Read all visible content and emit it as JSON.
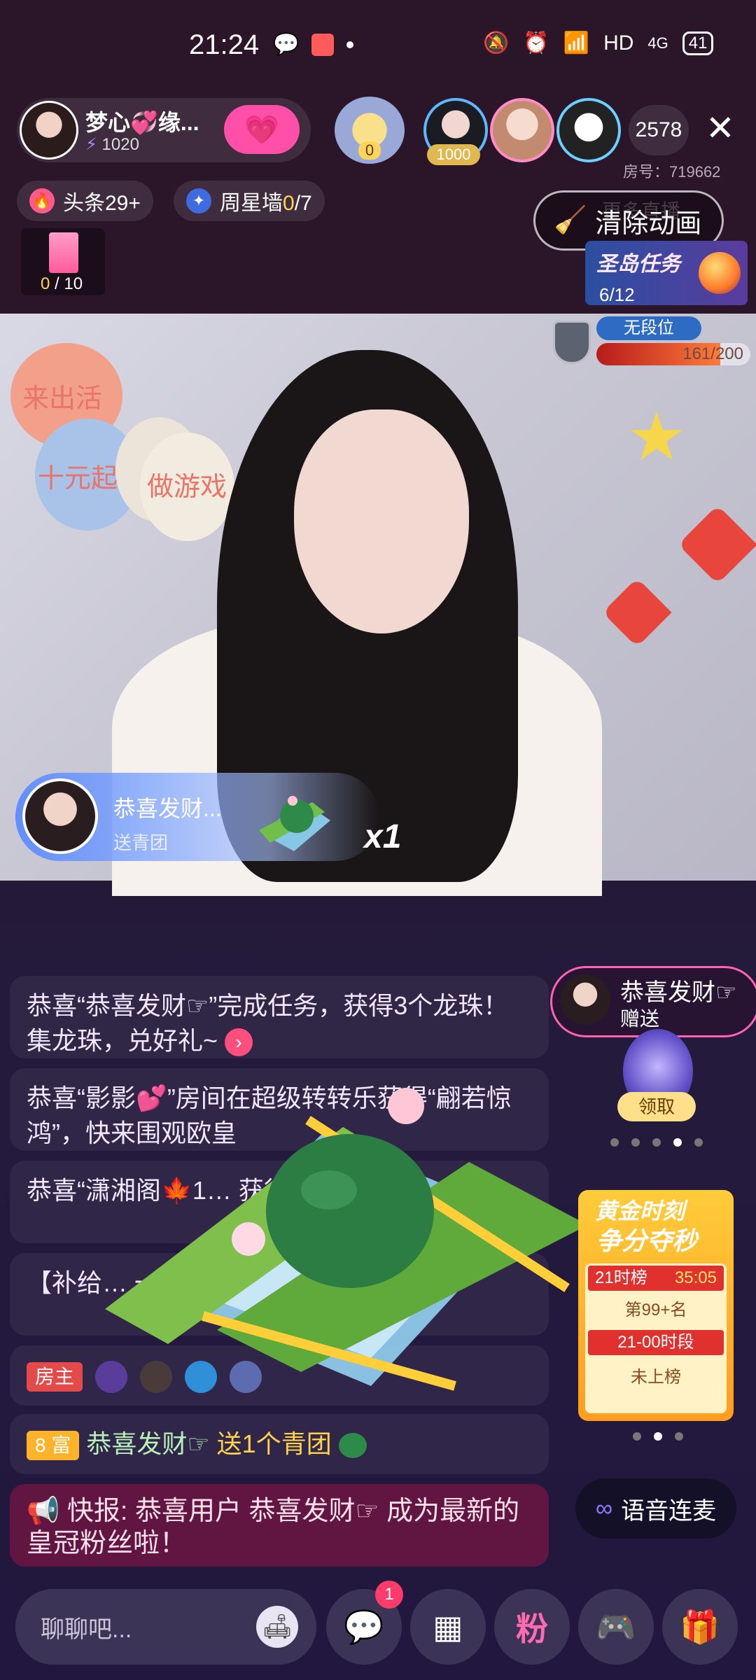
{
  "status_bar": {
    "time": "21:24",
    "network": "HD",
    "signal": "4G",
    "battery": "41"
  },
  "header": {
    "host_name": "梦心💞缘...",
    "host_fans": "1020",
    "rank_count": "0",
    "top_viewer_badge": "1000",
    "viewer_count": "2578",
    "room_number": "房号：719662",
    "close_icon": "✕"
  },
  "chips": {
    "headline": "头条29+",
    "weekly_star_label": "周星墙",
    "weekly_star_value": "0",
    "weekly_star_total": "/7"
  },
  "clear_animation": "清除动画",
  "more_live": "更多直播",
  "gift_card": {
    "current": "0",
    "total": " / 10"
  },
  "island_task": {
    "title": "圣岛任务",
    "progress": "6/12"
  },
  "video": {
    "balloons": [
      "来出活",
      "十元起",
      "做游戏"
    ],
    "rank": {
      "name": "无段位",
      "current": 161,
      "max": 200,
      "display": "161/200"
    }
  },
  "gift_toast": {
    "name": "恭喜发财...",
    "action": "送青团",
    "multiplier": "x1"
  },
  "chat": {
    "m1": {
      "text": "恭喜“恭喜发财☞”完成任务，获得3个龙珠！集龙珠，兑好礼~",
      "arrow": "›"
    },
    "m2": {
      "text": "恭喜“影影💕”房间在超级转转乐获得“翩若惊鸿”，快来围观欧皇"
    },
    "m3": {
      "text": "恭喜“潇湘阁🍁1… 获得“翩若惊鸿…"
    },
    "m4": {
      "text": "【补给… 一星际爵士…"
    },
    "m5": {
      "role": "房主"
    },
    "m6": {
      "level": "8 富",
      "user": "恭喜发财☞",
      "action": "送1个青团"
    },
    "bignews": "📢 快报: 恭喜用户 恭喜发财☞ 成为最新的皇冠粉丝啦！"
  },
  "right_panel": {
    "gift_notice_name": "恭喜发财☞",
    "gift_notice_action": "赠送",
    "claim": "领取",
    "golden_title_1": "黄金时刻",
    "golden_title_2": "争分夺秒",
    "hour_list": "21时榜",
    "countdown": "35:05",
    "rank_position": "第99+名",
    "time_slot": "21-00时段",
    "slot_status": "未上榜",
    "voice_link": "语音连麦"
  },
  "bottom_bar": {
    "placeholder": "聊聊吧...",
    "message_badge": "1",
    "fan_label": "粉"
  },
  "colors": {
    "accent_pink": "#ff4fa8",
    "gold": "#ffd54a",
    "bg": "#241a3c"
  }
}
